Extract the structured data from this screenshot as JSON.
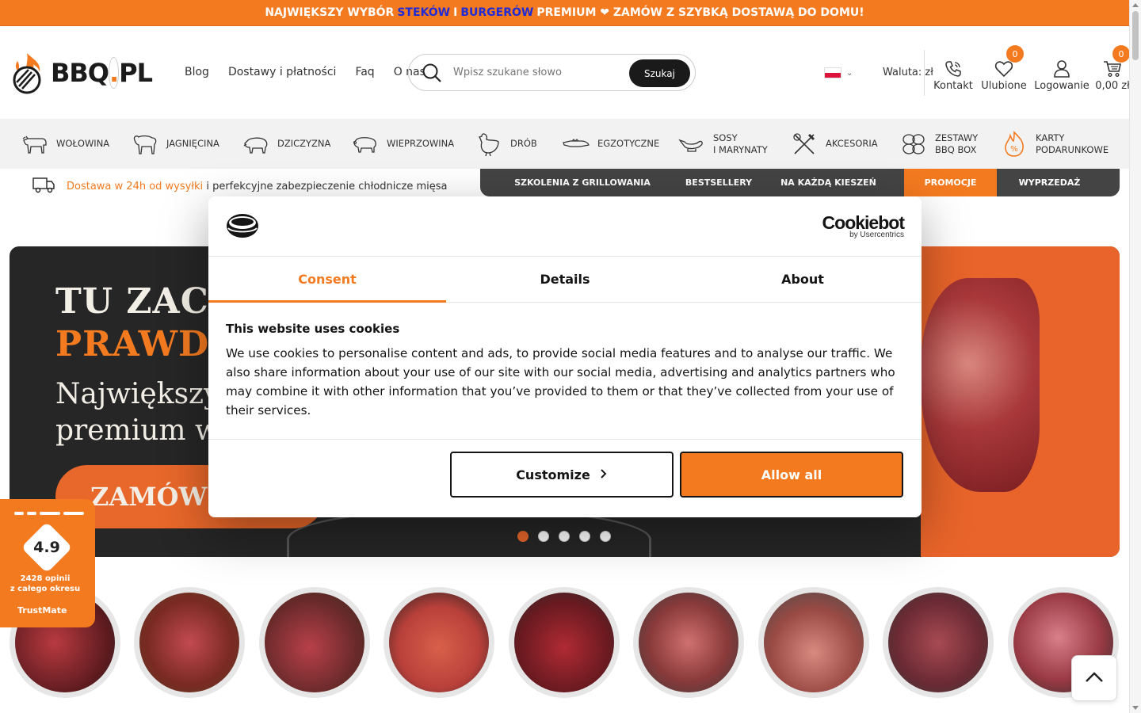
{
  "top_banner": {
    "part1": "NAJWIĘKSZY WYBÓR",
    "steaks": "STEKÓW",
    "and": "I",
    "burgers": "BURGERÓW",
    "part2": "PREMIUM ❤ ZAMÓW Z SZYBKĄ DOSTAWĄ DO DOMU!"
  },
  "logo": {
    "text_main": "BBQ",
    "text_dot": ".",
    "text_end": "PL"
  },
  "nav": [
    "Blog",
    "Dostawy i płatności",
    "Faq",
    "O nas"
  ],
  "search": {
    "placeholder": "Wpisz szukane słowo",
    "button": "Szukaj"
  },
  "currency": "Waluta: zł",
  "header_icons": {
    "contact": "Kontakt",
    "favorites": "Ulubione",
    "favorites_count": "0",
    "login": "Logowanie",
    "cart": "0,00 zł",
    "cart_count": "0"
  },
  "categories": [
    {
      "line1": "WOŁOWINA",
      "line2": "",
      "icon": "cow-icon"
    },
    {
      "line1": "JAGNIĘCINA",
      "line2": "",
      "icon": "lamb-icon"
    },
    {
      "line1": "DZICZYZNA",
      "line2": "",
      "icon": "boar-icon"
    },
    {
      "line1": "WIEPRZOWINA",
      "line2": "",
      "icon": "pig-icon"
    },
    {
      "line1": "DRÓB",
      "line2": "",
      "icon": "chicken-icon"
    },
    {
      "line1": "EGZOTYCZNE",
      "line2": "",
      "icon": "crocodile-icon"
    },
    {
      "line1": "SOSY",
      "line2": "I MARYNATY",
      "icon": "gravy-boat-icon"
    },
    {
      "line1": "AKCESORIA",
      "line2": "",
      "icon": "utensils-icon"
    },
    {
      "line1": "ZESTAWY",
      "line2": "BBQ BOX",
      "icon": "steaks-box-icon"
    },
    {
      "line1": "KARTY",
      "line2": "PODARUNKOWE",
      "icon": "gift-card-flame-icon"
    }
  ],
  "delivery": {
    "highlight": "Dostawa w 24h od wysyłki",
    "rest": " i perfekcyjne zabezpieczenie chłodnicze mięsa"
  },
  "pills": [
    {
      "label": "SZKOLENIA Z GRILLOWANIA",
      "active": false
    },
    {
      "label": "BESTSELLERY",
      "active": false
    },
    {
      "label": "NA KAŻDĄ KIESZEŃ",
      "active": false
    },
    {
      "label": "PROMOCJE",
      "active": true
    },
    {
      "label": "WYPRZEDAŻ",
      "active": false
    }
  ],
  "hero": {
    "line1": "TU ZACZ",
    "line2": "PRAWDZ",
    "line3a": "Największy",
    "line3b": "premium w",
    "cta": "ZAMÓW",
    "slide_count": 5,
    "active_slide": 1
  },
  "trustmate": {
    "score": "4.9",
    "count": "2428 opinii",
    "period": "z całego okresu",
    "brand": "TrustMate"
  },
  "cookie_dialog": {
    "brand": "Cookiebot",
    "brand_by": "by Usercentrics",
    "tabs": [
      "Consent",
      "Details",
      "About"
    ],
    "active_tab": "Consent",
    "title": "This website uses cookies",
    "text": "We use cookies to personalise content and ads, to provide social media features and to analyse our traffic. We also share information about your use of our site with our social media, advertising and analytics partners who may combine it with other information that you’ve provided to them or that they’ve collected from your use of their services.",
    "customize": "Customize",
    "allow_all": "Allow all"
  },
  "colors": {
    "brand_orange": "#f47a20",
    "dark": "#444444",
    "banner_highlight": "#1e2bd6"
  }
}
